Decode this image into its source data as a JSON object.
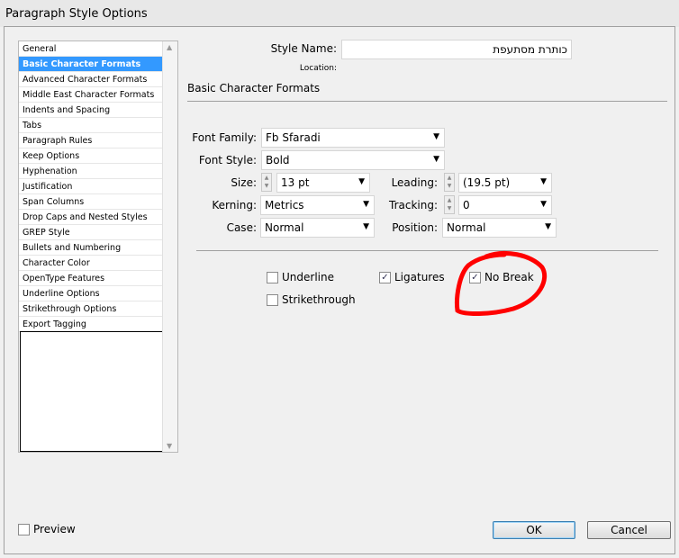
{
  "window": {
    "title": "Paragraph Style Options"
  },
  "sidebar": {
    "items": [
      "General",
      "Basic Character Formats",
      "Advanced Character Formats",
      "Middle East Character Formats",
      "Indents and Spacing",
      "Tabs",
      "Paragraph Rules",
      "Keep Options",
      "Hyphenation",
      "Justification",
      "Span Columns",
      "Drop Caps and Nested Styles",
      "GREP Style",
      "Bullets and Numbering",
      "Character Color",
      "OpenType Features",
      "Underline Options",
      "Strikethrough Options",
      "Export Tagging"
    ],
    "selected": 1
  },
  "style_name": {
    "label": "Style Name:",
    "value": "כותרת מסתעפת"
  },
  "location": {
    "label": "Location:"
  },
  "section_title": "Basic Character Formats",
  "fields": {
    "font_family": {
      "label": "Font Family:",
      "value": "Fb Sfaradi"
    },
    "font_style": {
      "label": "Font Style:",
      "value": "Bold"
    },
    "size": {
      "label": "Size:",
      "value": "13 pt"
    },
    "leading": {
      "label": "Leading:",
      "value": "(19.5 pt)"
    },
    "kerning": {
      "label": "Kerning:",
      "value": "Metrics"
    },
    "tracking": {
      "label": "Tracking:",
      "value": "0"
    },
    "case": {
      "label": "Case:",
      "value": "Normal"
    },
    "position": {
      "label": "Position:",
      "value": "Normal"
    }
  },
  "checkboxes": {
    "underline": {
      "label": "Underline",
      "checked": false
    },
    "ligatures": {
      "label": "Ligatures",
      "checked": true
    },
    "no_break": {
      "label": "No Break",
      "checked": true
    },
    "strikethrough": {
      "label": "Strikethrough",
      "checked": false
    }
  },
  "preview": {
    "label": "Preview",
    "checked": false
  },
  "buttons": {
    "ok": "OK",
    "cancel": "Cancel"
  },
  "annotation_color": "#ff0000"
}
